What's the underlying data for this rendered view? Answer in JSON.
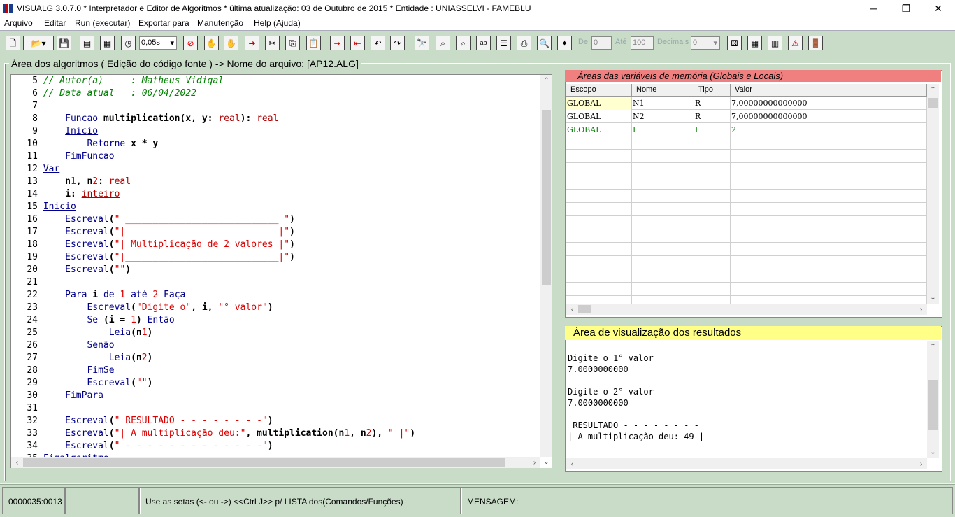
{
  "window": {
    "title": "VISUALG 3.0.7.0 * Interpretador e Editor de Algoritmos * última atualização: 03 de Outubro de 2015 * Entidade : UNIASSELVI - FAMEBLU"
  },
  "menu": [
    "Arquivo",
    "Editar",
    "Run (executar)",
    "Exportar para",
    "Manutenção",
    "Help (Ajuda)"
  ],
  "toolbar": {
    "speed_value": "0,05s",
    "de_label": "De:",
    "de_value": "0",
    "ate_label": "Até",
    "ate_value": "100",
    "decimais_label": "Decimais",
    "decimais_value": "0"
  },
  "editor": {
    "legend": "Área dos algoritmos ( Edição do código fonte ) -> Nome do arquivo: [AP12.ALG]",
    "lines": [
      {
        "n": "5",
        "t": "// Autor(a)     : Matheus Vidigal"
      },
      {
        "n": "6",
        "t": "// Data atual   : 06/04/2022"
      },
      {
        "n": "7",
        "t": ""
      },
      {
        "n": "8",
        "t": "    Funcao multiplication(x, y: real): real"
      },
      {
        "n": "9",
        "t": "    Inicio"
      },
      {
        "n": "10",
        "t": "        Retorne x * y"
      },
      {
        "n": "11",
        "t": "    FimFuncao"
      },
      {
        "n": "12",
        "t": "Var"
      },
      {
        "n": "13",
        "t": "    n1, n2: real"
      },
      {
        "n": "14",
        "t": "    i: inteiro"
      },
      {
        "n": "15",
        "t": "Inicio"
      },
      {
        "n": "16",
        "t": "    Escreval(\" ____________________________ \")"
      },
      {
        "n": "17",
        "t": "    Escreval(\"|                            |\")"
      },
      {
        "n": "18",
        "t": "    Escreval(\"| Multiplicação de 2 valores |\")"
      },
      {
        "n": "19",
        "t": "    Escreval(\"|____________________________|\")"
      },
      {
        "n": "20",
        "t": "    Escreval(\"\")"
      },
      {
        "n": "21",
        "t": ""
      },
      {
        "n": "22",
        "t": "    Para i de 1 até 2 Faça"
      },
      {
        "n": "23",
        "t": "        Escreval(\"Digite o\", i, \"° valor\")"
      },
      {
        "n": "24",
        "t": "        Se (i = 1) Então"
      },
      {
        "n": "25",
        "t": "            Leia(n1)"
      },
      {
        "n": "26",
        "t": "        Senão"
      },
      {
        "n": "27",
        "t": "            Leia(n2)"
      },
      {
        "n": "28",
        "t": "        FimSe"
      },
      {
        "n": "29",
        "t": "        Escreval(\"\")"
      },
      {
        "n": "30",
        "t": "    FimPara"
      },
      {
        "n": "31",
        "t": ""
      },
      {
        "n": "32",
        "t": "    Escreval(\" RESULTADO - - - - - - - -\")"
      },
      {
        "n": "33",
        "t": "    Escreval(\"| A multiplicação deu:\", multiplication(n1, n2), \" |\")"
      },
      {
        "n": "34",
        "t": "    Escreval(\" - - - - - - - - - - - - -\")"
      },
      {
        "n": "35",
        "t": "Fimalgoritmo"
      }
    ]
  },
  "variables": {
    "legend": "Áreas das variáveis de memória (Globais e Locais)",
    "headers": [
      "Escopo",
      "Nome",
      "Tipo",
      "Valor"
    ],
    "rows": [
      [
        "GLOBAL",
        "N1",
        "R",
        "7,00000000000000"
      ],
      [
        "GLOBAL",
        "N2",
        "R",
        "7,00000000000000"
      ],
      [
        "GLOBAL",
        "I",
        "I",
        "2"
      ]
    ]
  },
  "output": {
    "legend": "Área de visualização dos resultados",
    "text": "Digite o 1° valor\n7.0000000000\n\nDigite o 2° valor\n7.0000000000\n\n RESULTADO - - - - - - - -\n| A multiplicação deu: 49 |\n - - - - - - - - - - - - -"
  },
  "status": {
    "position": "0000035:0013",
    "hint": "Use as setas (<- ou ->) <<Ctrl J>> p/ LISTA dos(Comandos/Funções)",
    "message_label": "MENSAGEM:"
  },
  "colors": {
    "panel_bg": "#c8dcc8",
    "vars_legend_bg": "#f08080",
    "output_legend_bg": "#ffff88",
    "comment": "#008000",
    "keyword": "#00008b",
    "string": "#dd0000"
  }
}
